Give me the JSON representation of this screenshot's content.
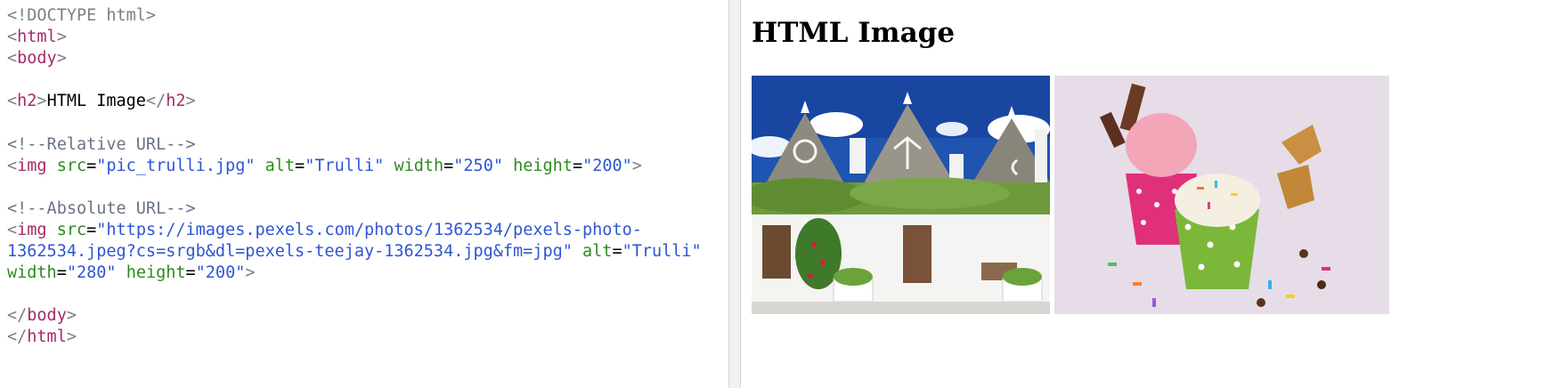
{
  "editor": {
    "lines": [
      [
        {
          "c": "br",
          "t": "<!DOCTYPE html>"
        }
      ],
      [
        {
          "c": "br",
          "t": "<"
        },
        {
          "c": "tag",
          "t": "html"
        },
        {
          "c": "br",
          "t": ">"
        }
      ],
      [
        {
          "c": "br",
          "t": "<"
        },
        {
          "c": "tag",
          "t": "body"
        },
        {
          "c": "br",
          "t": ">"
        }
      ],
      [],
      [
        {
          "c": "br",
          "t": "<"
        },
        {
          "c": "tag",
          "t": "h2"
        },
        {
          "c": "br",
          "t": ">"
        },
        {
          "c": "txt",
          "t": "HTML Image"
        },
        {
          "c": "br",
          "t": "</"
        },
        {
          "c": "tag",
          "t": "h2"
        },
        {
          "c": "br",
          "t": ">"
        }
      ],
      [],
      [
        {
          "c": "cmt",
          "t": "<!--Relative URL-->"
        }
      ],
      [
        {
          "c": "br",
          "t": "<"
        },
        {
          "c": "tag",
          "t": "img"
        },
        {
          "c": "txt",
          "t": " "
        },
        {
          "c": "attr",
          "t": "src"
        },
        {
          "c": "txt",
          "t": "="
        },
        {
          "c": "val",
          "t": "\"pic_trulli.jpg\""
        },
        {
          "c": "txt",
          "t": " "
        },
        {
          "c": "attr",
          "t": "alt"
        },
        {
          "c": "txt",
          "t": "="
        },
        {
          "c": "val",
          "t": "\"Trulli\""
        },
        {
          "c": "txt",
          "t": " "
        },
        {
          "c": "attr",
          "t": "width"
        },
        {
          "c": "txt",
          "t": "="
        },
        {
          "c": "val",
          "t": "\"250\""
        },
        {
          "c": "txt",
          "t": " "
        },
        {
          "c": "attr",
          "t": "height"
        },
        {
          "c": "txt",
          "t": "="
        },
        {
          "c": "val",
          "t": "\"200\""
        },
        {
          "c": "br",
          "t": ">"
        }
      ],
      [],
      [
        {
          "c": "cmt",
          "t": "<!--Absolute URL-->"
        }
      ],
      [
        {
          "c": "br",
          "t": "<"
        },
        {
          "c": "tag",
          "t": "img"
        },
        {
          "c": "txt",
          "t": " "
        },
        {
          "c": "attr",
          "t": "src"
        },
        {
          "c": "txt",
          "t": "="
        },
        {
          "c": "val",
          "t": "\"https://images.pexels.com/photos/1362534/pexels-photo-"
        }
      ],
      [
        {
          "c": "val",
          "t": "1362534.jpeg?cs=srgb&dl=pexels-teejay-1362534.jpg&fm=jpg\""
        },
        {
          "c": "txt",
          "t": " "
        },
        {
          "c": "attr",
          "t": "alt"
        },
        {
          "c": "txt",
          "t": "="
        },
        {
          "c": "val",
          "t": "\"Trulli\""
        }
      ],
      [
        {
          "c": "attr",
          "t": "width"
        },
        {
          "c": "txt",
          "t": "="
        },
        {
          "c": "val",
          "t": "\"280\""
        },
        {
          "c": "txt",
          "t": " "
        },
        {
          "c": "attr",
          "t": "height"
        },
        {
          "c": "txt",
          "t": "="
        },
        {
          "c": "val",
          "t": "\"200\""
        },
        {
          "c": "br",
          "t": ">"
        }
      ],
      [],
      [
        {
          "c": "br",
          "t": "</"
        },
        {
          "c": "tag",
          "t": "body"
        },
        {
          "c": "br",
          "t": ">"
        }
      ],
      [
        {
          "c": "br",
          "t": "</"
        },
        {
          "c": "tag",
          "t": "html"
        },
        {
          "c": "br",
          "t": ">"
        }
      ]
    ]
  },
  "preview": {
    "heading": "HTML Image",
    "images": [
      {
        "alt": "Trulli",
        "subject": "trulli-houses-photo"
      },
      {
        "alt": "Trulli",
        "subject": "ice-cream-photo"
      }
    ]
  },
  "colors": {
    "tag": "#a52a6b",
    "bracket": "#7f7f7f",
    "comment": "#6a7483",
    "attribute": "#2e8b1e",
    "value": "#2f55d4"
  }
}
